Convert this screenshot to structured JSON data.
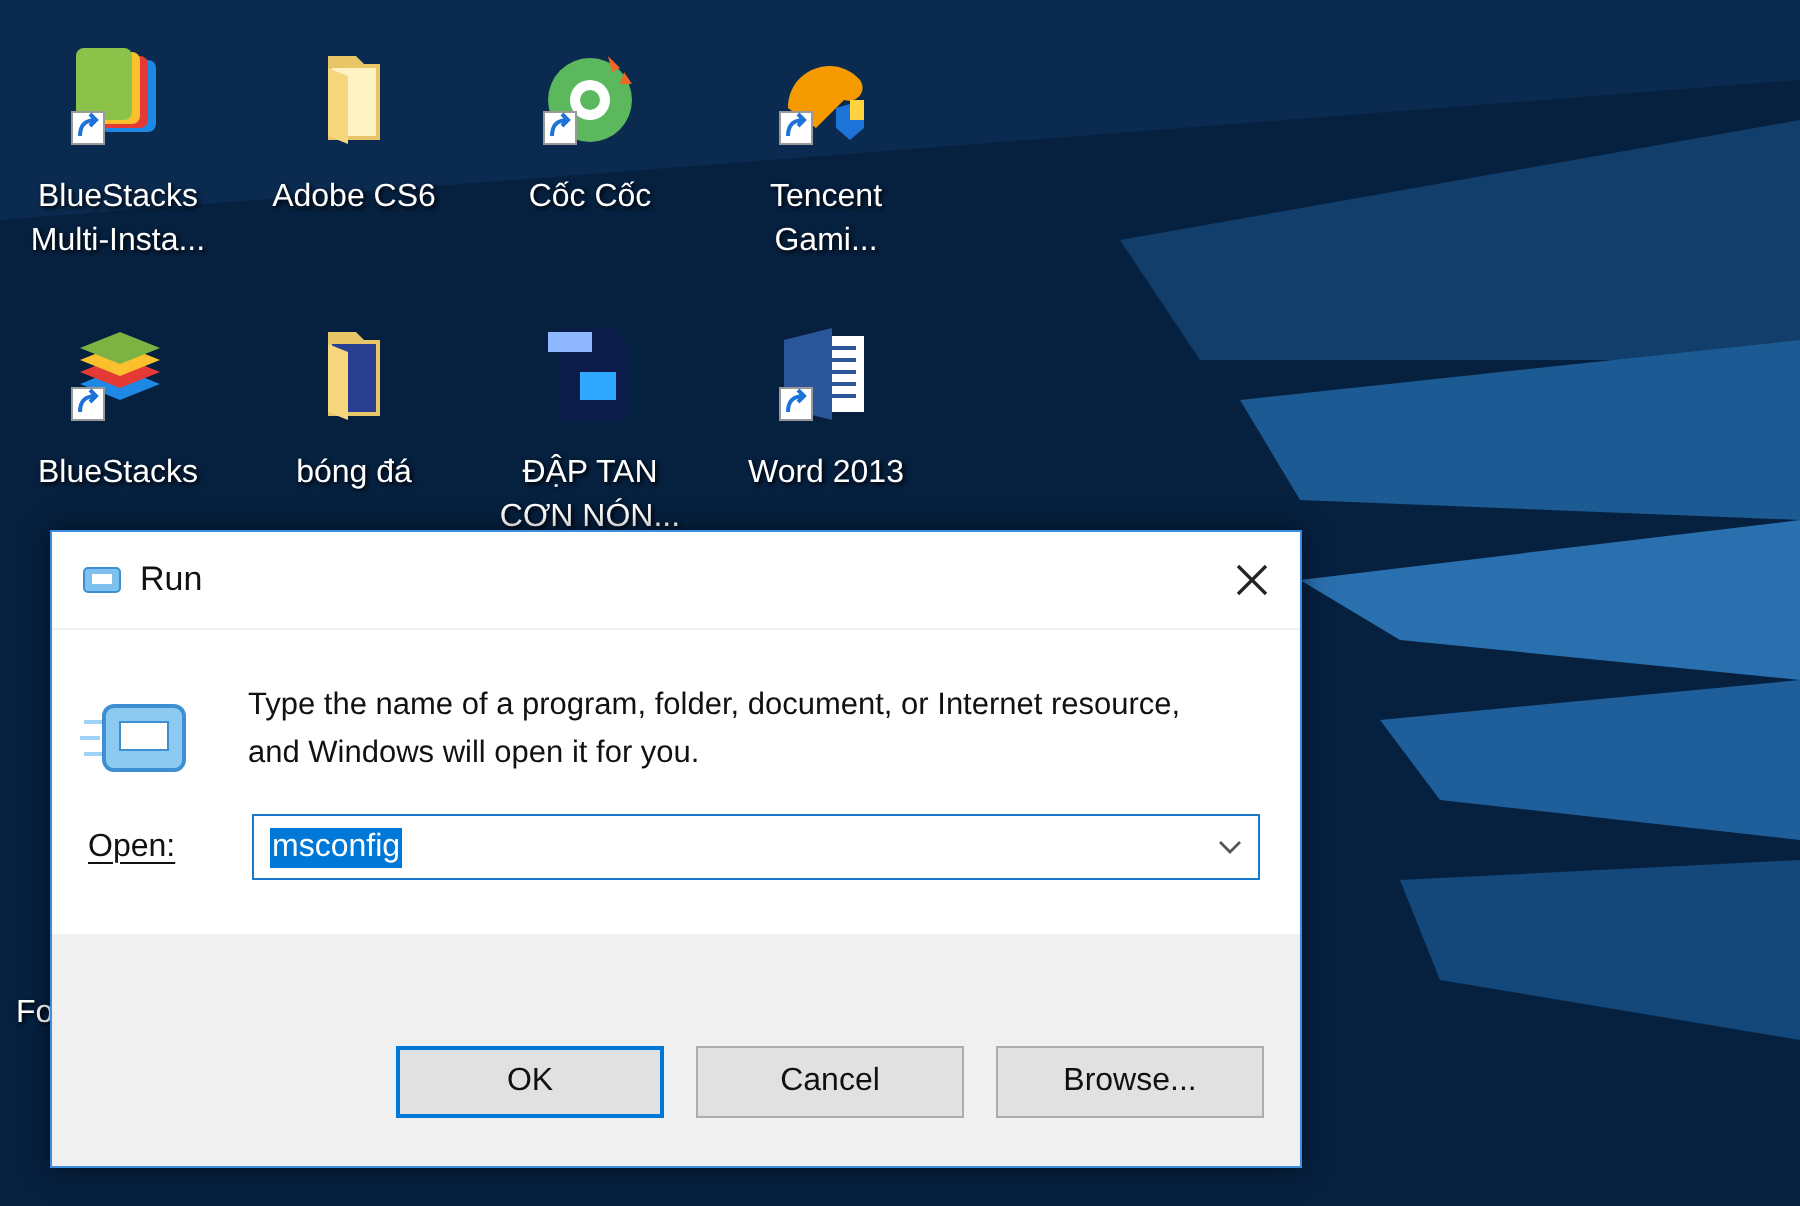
{
  "desktop": {
    "icons": [
      {
        "label": "BlueStacks Multi-Insta...",
        "kind": "app-tile",
        "shortcut": true
      },
      {
        "label": "Adobe CS6",
        "kind": "folder",
        "shortcut": false
      },
      {
        "label": "Cốc Cốc",
        "kind": "disc",
        "shortcut": true
      },
      {
        "label": "Tencent Gami...",
        "kind": "mascot",
        "shortcut": true
      },
      {
        "label": "BlueStacks",
        "kind": "layers",
        "shortcut": true
      },
      {
        "label": "bóng đá",
        "kind": "photo-folder",
        "shortcut": false
      },
      {
        "label": "ĐẬP TAN CƠN NÓN...",
        "kind": "psd-file",
        "shortcut": false
      },
      {
        "label": "Word 2013",
        "kind": "word-file",
        "shortcut": true
      }
    ],
    "hidden_label": "Fo"
  },
  "dialog": {
    "title": "Run",
    "message": "Type the name of a program, folder, document, or Internet resource, and Windows will open it for you.",
    "open_label": "Open:",
    "value": "msconfig",
    "value_selected": true,
    "buttons": [
      {
        "label": "OK",
        "default": true
      },
      {
        "label": "Cancel",
        "default": false
      },
      {
        "label": "Browse..."
      }
    ]
  }
}
